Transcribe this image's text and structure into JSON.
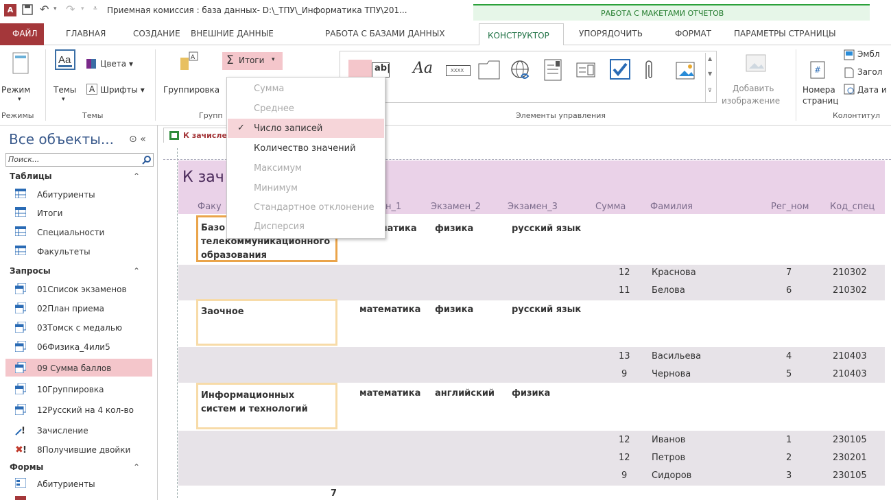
{
  "window": {
    "title": "Приемная комиссия : база данных- D:\\_ТПУ\\_Информатика ТПУ\\201...",
    "app_icon": "A",
    "context_group": "РАБОТА С МАКЕТАМИ ОТЧЕТОВ"
  },
  "tabs": [
    "ФАЙЛ",
    "ГЛАВНАЯ",
    "СОЗДАНИЕ",
    "ВНЕШНИЕ ДАННЫЕ",
    "РАБОТА С БАЗАМИ ДАННЫХ",
    "КОНСТРУКТОР",
    "УПОРЯДОЧИТЬ",
    "ФОРМАТ",
    "ПАРАМЕТРЫ СТРАНИЦЫ"
  ],
  "active_tab": "КОНСТРУКТОР",
  "ribbon": {
    "mode": "Режим",
    "themes": "Темы",
    "colors": "Цвета",
    "fonts": "Шрифты",
    "grouping": "Группировка",
    "totals": "Итоги",
    "add_image": "Добавить",
    "add_image2": "изображение",
    "page_numbers": "Номера",
    "page_numbers2": "страниц",
    "emblem": "Эмбл",
    "heading": "Загол",
    "date": "Дата и",
    "group_modes": "Режимы",
    "group_themes": "Темы",
    "group_grouping": "Групп",
    "group_controls": "Элементы управления",
    "group_header": "Колонтитул"
  },
  "totals_menu": [
    {
      "label": "Сумма",
      "enabled": false
    },
    {
      "label": "Среднее",
      "enabled": false
    },
    {
      "label": "Число записей",
      "enabled": true,
      "checked": true
    },
    {
      "label": "Количество значений",
      "enabled": true
    },
    {
      "label": "Максимум",
      "enabled": false
    },
    {
      "label": "Минимум",
      "enabled": false
    },
    {
      "label": "Стандартное отклонение",
      "enabled": false
    },
    {
      "label": "Дисперсия",
      "enabled": false
    }
  ],
  "nav": {
    "title": "Все объекты...",
    "search_placeholder": "Поиск...",
    "sections": [
      {
        "name": "Таблицы",
        "items": [
          "Абитуриенты",
          "Итоги",
          "Специальности",
          "Факультеты"
        ]
      },
      {
        "name": "Запросы",
        "items": [
          "01Список экзаменов",
          "02План приема",
          "03Томск с медалью",
          "06Физика_4или5",
          "09 Сумма баллов",
          "10Группировка",
          "12Русский на 4 кол-во",
          "Зачисление",
          "8Получившие двойки"
        ]
      },
      {
        "name": "Формы",
        "items": [
          "Абитуриенты"
        ]
      }
    ],
    "selected": "09 Сумма баллов"
  },
  "document": {
    "tab_label": "К зачисле",
    "report_title": "К зач",
    "columns": [
      "Факу",
      "ен_1",
      "Экзамен_2",
      "Экзамен_3",
      "Сумма",
      "Фамилия",
      "Рег_ном",
      "Код_спец"
    ],
    "groups": [
      {
        "faculty": [
          "Базо",
          "телекоммуникационного",
          "образования"
        ],
        "exams": [
          "матика",
          "физика",
          "русский язык"
        ],
        "rows": [
          {
            "sum": "12",
            "name": "Краснова",
            "reg": "7",
            "code": "210302"
          },
          {
            "sum": "11",
            "name": "Белова",
            "reg": "6",
            "code": "210302"
          }
        ]
      },
      {
        "faculty": [
          "Заочное"
        ],
        "exams": [
          "математика",
          "физика",
          "русский язык"
        ],
        "rows": [
          {
            "sum": "13",
            "name": "Васильева",
            "reg": "4",
            "code": "210403"
          },
          {
            "sum": "9",
            "name": "Чернова",
            "reg": "5",
            "code": "210403"
          }
        ]
      },
      {
        "faculty": [
          "Информационных",
          "систем и технологий"
        ],
        "exams": [
          "математика",
          "английский",
          "физика"
        ],
        "rows": [
          {
            "sum": "12",
            "name": "Иванов",
            "reg": "1",
            "code": "230105"
          },
          {
            "sum": "12",
            "name": "Петров",
            "reg": "2",
            "code": "230201"
          },
          {
            "sum": "9",
            "name": "Сидоров",
            "reg": "3",
            "code": "230105"
          }
        ]
      }
    ],
    "total_count": "7"
  },
  "colors": {
    "file_tab": "#a4373a",
    "accent_green": "#217346",
    "selected_item": "#f4c6cb",
    "report_header": "#ead2e8"
  }
}
